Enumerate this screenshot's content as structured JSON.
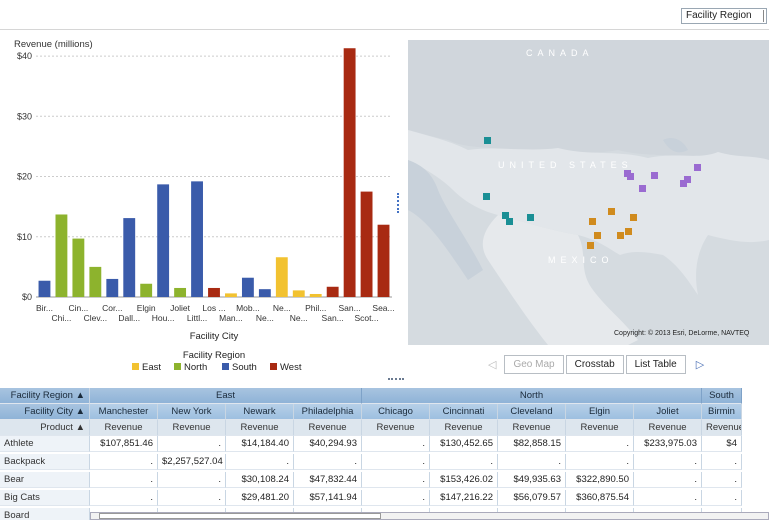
{
  "controls": {
    "region_select": "Facility Region"
  },
  "chart_data": {
    "type": "bar",
    "ylabel": "Revenue (millions)",
    "xlabel": "Facility City",
    "ylim": [
      0,
      43
    ],
    "y_ticks": [
      "$0",
      "$10",
      "$20",
      "$30",
      "$40"
    ],
    "y_tick_values": [
      0,
      10,
      20,
      30,
      40
    ],
    "categories": [
      "Bir...",
      "Chi...",
      "Cin...",
      "Clev...",
      "Cor...",
      "Dall...",
      "Elgin",
      "Hou...",
      "Joliet",
      "Littl...",
      "Los ...",
      "Man...",
      "Mob...",
      "Ne...",
      "Ne...",
      "Ne...",
      "Phil...",
      "San...",
      "San...",
      "Scot...",
      "Sea..."
    ],
    "region_of_category": [
      "South",
      "North",
      "North",
      "North",
      "South",
      "South",
      "North",
      "South",
      "North",
      "South",
      "West",
      "East",
      "South",
      "South",
      "East",
      "East",
      "East",
      "West",
      "West",
      "West",
      "West"
    ],
    "values": [
      2.7,
      13.7,
      9.7,
      5.0,
      3.0,
      13.1,
      2.2,
      18.7,
      1.5,
      19.2,
      1.5,
      0.6,
      3.2,
      1.3,
      6.6,
      1.1,
      0.5,
      1.7,
      41.3,
      17.5,
      12.0
    ],
    "legend_title": "Facility Region",
    "legend": [
      {
        "name": "East",
        "color": "#f2c230"
      },
      {
        "name": "North",
        "color": "#8db32d"
      },
      {
        "name": "South",
        "color": "#3a5baa"
      },
      {
        "name": "West",
        "color": "#a82a12"
      }
    ],
    "grid": true
  },
  "map": {
    "labels": [
      "CANADA",
      "UNITED STATES",
      "MEXICO"
    ],
    "copyright": "Copyright: © 2013 Esri, DeLorme, NAVTEQ"
  },
  "tabs": {
    "geomap": "Geo Map",
    "crosstab": "Crosstab",
    "listtable": "List Table"
  },
  "crosstab": {
    "left_headers": [
      "Facility Region ▲",
      "Facility City ▲",
      "Product ▲"
    ],
    "regions": [
      {
        "name": "East",
        "span": 4
      },
      {
        "name": "North",
        "span": 5
      },
      {
        "name": "South",
        "span": 1
      }
    ],
    "cities": [
      "Manchester",
      "New York",
      "Newark",
      "Philadelphia",
      "Chicago",
      "Cincinnati",
      "Cleveland",
      "Elgin",
      "Joliet",
      "Birmin"
    ],
    "measure": "Revenue",
    "rows": [
      {
        "product": "Athlete",
        "values": [
          "$107,851.46",
          ".",
          "$14,184.40",
          "$40,294.93",
          ".",
          "$130,452.65",
          "$82,858.15",
          ".",
          "$233,975.03",
          "$4"
        ]
      },
      {
        "product": "Backpack",
        "values": [
          ".",
          "$2,257,527.04",
          ".",
          ".",
          ".",
          ".",
          ".",
          ".",
          ".",
          "."
        ]
      },
      {
        "product": "Bear",
        "values": [
          ".",
          ".",
          "$30,108.24",
          "$47,832.44",
          ".",
          "$153,426.02",
          "$49,935.63",
          "$322,890.50",
          ".",
          "."
        ]
      },
      {
        "product": "Big Cats",
        "values": [
          ".",
          ".",
          "$29,481.20",
          "$57,141.94",
          ".",
          "$147,216.22",
          "$56,079.57",
          "$360,875.54",
          ".",
          "."
        ]
      },
      {
        "product": "Board",
        "values": [
          "",
          "",
          "",
          "",
          "",
          "",
          "",
          "",
          "",
          ""
        ]
      }
    ]
  }
}
